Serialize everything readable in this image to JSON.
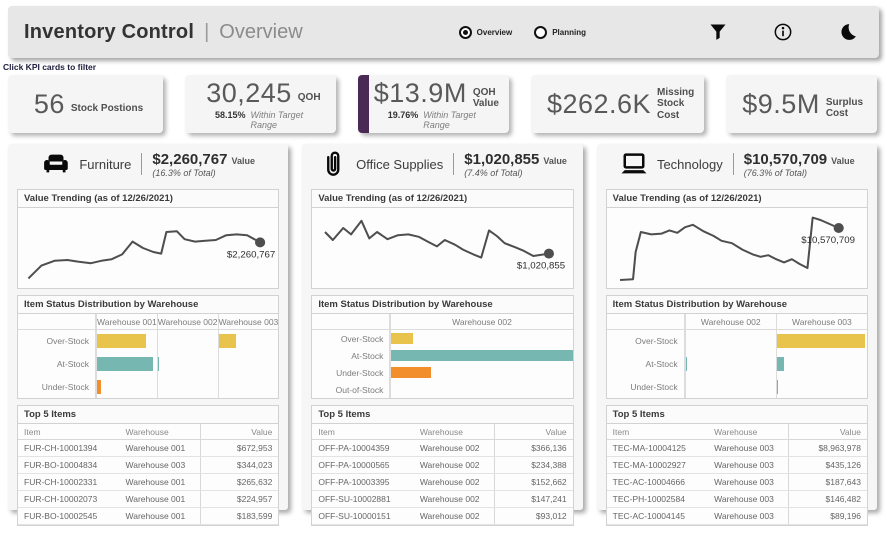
{
  "header": {
    "title": "Inventory Control",
    "separator": "|",
    "subtitle": "Overview",
    "views": [
      {
        "label": "Overview",
        "selected": true
      },
      {
        "label": "Planning",
        "selected": false
      }
    ],
    "icons": [
      "filter-icon",
      "info-icon",
      "dark-mode-icon"
    ]
  },
  "hint": "Click KPI cards to filter",
  "accent_color": "#4A2A55",
  "status_colors": {
    "Over-Stock": "#E8C44C",
    "At-Stock": "#76B7B2",
    "Under-Stock": "#F28E2B",
    "Out-of-Stock": "#F28E2B"
  },
  "trend_line_color": "#4e4e4e",
  "kpis": [
    {
      "value": "56",
      "label": "Stock Postions",
      "selected": false
    },
    {
      "value": "30,245",
      "label": "QOH",
      "sub_pct": "58.15%",
      "sub_text": "Within Target Range",
      "selected": false
    },
    {
      "value": "$13.9M",
      "label": "QOH Value",
      "sub_pct": "19.76%",
      "sub_text": "Within Target Range",
      "selected": true
    },
    {
      "value": "$262.6K",
      "label_lines": [
        "Missing",
        "Stock",
        "Cost"
      ],
      "selected": false
    },
    {
      "value": "$9.5M",
      "label": "Surplus Cost",
      "selected": false
    }
  ],
  "categories": [
    {
      "name": "Furniture",
      "icon": "couch-icon",
      "value": "$2,260,767",
      "value_suffix": "Value",
      "share": "(16.3% of Total)",
      "trend": {
        "title": "Value Trending (as of 12/26/2021)",
        "type": "line",
        "points": [
          [
            4,
            88
          ],
          [
            9,
            72
          ],
          [
            14,
            66
          ],
          [
            19,
            65
          ],
          [
            23,
            67
          ],
          [
            28,
            69
          ],
          [
            32,
            66
          ],
          [
            36,
            64
          ],
          [
            40,
            58
          ],
          [
            44,
            42
          ],
          [
            48,
            50
          ],
          [
            52,
            55
          ],
          [
            55,
            57
          ],
          [
            57,
            30
          ],
          [
            61,
            29
          ],
          [
            64,
            39
          ],
          [
            68,
            42
          ],
          [
            72,
            41
          ],
          [
            76,
            40
          ],
          [
            80,
            34
          ],
          [
            84,
            33
          ],
          [
            88,
            34
          ],
          [
            93,
            43
          ]
        ],
        "end_label": "$2,260,767"
      },
      "status": {
        "title": "Item Status Distribution by Warehouse",
        "columns": [
          "Warehouse 001",
          "Warehouse 002",
          "Warehouse 003"
        ],
        "rows": [
          {
            "label": "Over-Stock",
            "values": [
              0.82,
              0,
              0.3
            ]
          },
          {
            "label": "At-Stock",
            "values": [
              0.93,
              0.02,
              0
            ]
          },
          {
            "label": "Under-Stock",
            "values": [
              0.07,
              0,
              0
            ]
          }
        ]
      },
      "top5": {
        "title": "Top 5 Items",
        "headers": [
          "Item",
          "Warehouse",
          "Value"
        ],
        "rows": [
          [
            "FUR-CH-10001394",
            "Warehouse 001",
            "$672,953"
          ],
          [
            "FUR-BO-10004834",
            "Warehouse 003",
            "$344,023"
          ],
          [
            "FUR-CH-10002331",
            "Warehouse 001",
            "$265,632"
          ],
          [
            "FUR-CH-10002073",
            "Warehouse 001",
            "$224,957"
          ],
          [
            "FUR-BO-10002545",
            "Warehouse 001",
            "$183,599"
          ]
        ]
      }
    },
    {
      "name": "Office Supplies",
      "icon": "paperclip-icon",
      "value": "$1,020,855",
      "value_suffix": "Value",
      "share": "(7.4% of Total)",
      "trend": {
        "title": "Value Trending (as of 12/26/2021)",
        "type": "line",
        "points": [
          [
            5,
            30
          ],
          [
            8,
            40
          ],
          [
            12,
            25
          ],
          [
            15,
            33
          ],
          [
            19,
            16
          ],
          [
            22,
            38
          ],
          [
            25,
            30
          ],
          [
            29,
            39
          ],
          [
            33,
            34
          ],
          [
            37,
            33
          ],
          [
            41,
            36
          ],
          [
            45,
            43
          ],
          [
            48,
            48
          ],
          [
            51,
            40
          ],
          [
            55,
            46
          ],
          [
            58,
            52
          ],
          [
            62,
            58
          ],
          [
            65,
            62
          ],
          [
            68,
            28
          ],
          [
            71,
            35
          ],
          [
            74,
            44
          ],
          [
            78,
            49
          ],
          [
            81,
            53
          ],
          [
            85,
            60
          ],
          [
            91,
            57
          ]
        ],
        "end_label": "$1,020,855"
      },
      "status": {
        "title": "Item Status Distribution by Warehouse",
        "columns": [
          "Warehouse 002"
        ],
        "rows": [
          {
            "label": "Over-Stock",
            "values": [
              0.12
            ]
          },
          {
            "label": "At-Stock",
            "values": [
              1.0
            ]
          },
          {
            "label": "Under-Stock",
            "values": [
              0.22
            ]
          },
          {
            "label": "Out-of-Stock",
            "values": [
              0
            ]
          }
        ]
      },
      "top5": {
        "title": "Top 5 Items",
        "headers": [
          "Item",
          "Warehouse",
          "Value"
        ],
        "rows": [
          [
            "OFF-PA-10004359",
            "Warehouse 002",
            "$366,136"
          ],
          [
            "OFF-PA-10000565",
            "Warehouse 002",
            "$234,388"
          ],
          [
            "OFF-PA-10003395",
            "Warehouse 002",
            "$152,662"
          ],
          [
            "OFF-SU-10002881",
            "Warehouse 002",
            "$147,241"
          ],
          [
            "OFF-SU-10000151",
            "Warehouse 002",
            "$93,012"
          ]
        ]
      }
    },
    {
      "name": "Technology",
      "icon": "laptop-icon",
      "value": "$10,570,709",
      "value_suffix": "Value",
      "share": "(76.3% of Total)",
      "trend": {
        "title": "Value Trending (as of 12/26/2021)",
        "type": "line",
        "points": [
          [
            5,
            90
          ],
          [
            10,
            89
          ],
          [
            11,
            55
          ],
          [
            13,
            30
          ],
          [
            17,
            33
          ],
          [
            21,
            32
          ],
          [
            24,
            28
          ],
          [
            27,
            31
          ],
          [
            30,
            24
          ],
          [
            33,
            21
          ],
          [
            37,
            29
          ],
          [
            41,
            35
          ],
          [
            44,
            41
          ],
          [
            48,
            44
          ],
          [
            52,
            52
          ],
          [
            56,
            58
          ],
          [
            59,
            61
          ],
          [
            62,
            59
          ],
          [
            65,
            64
          ],
          [
            68,
            68
          ],
          [
            71,
            64
          ],
          [
            74,
            70
          ],
          [
            77,
            75
          ],
          [
            79,
            12
          ],
          [
            82,
            15
          ],
          [
            89,
            25
          ]
        ],
        "end_label": "$10,570,709"
      },
      "status": {
        "title": "Item Status Distribution by Warehouse",
        "columns": [
          "Warehouse 002",
          "Warehouse 003"
        ],
        "rows": [
          {
            "label": "Over-Stock",
            "values": [
              0,
              0.98
            ]
          },
          {
            "label": "At-Stock",
            "values": [
              0.015,
              0.08
            ]
          },
          {
            "label": "Under-Stock",
            "values": [
              0,
              0.005
            ]
          }
        ]
      },
      "top5": {
        "title": "Top 5 Items",
        "headers": [
          "Item",
          "Warehouse",
          "Value"
        ],
        "rows": [
          [
            "TEC-MA-10004125",
            "Warehouse 003",
            "$8,963,978"
          ],
          [
            "TEC-MA-10002927",
            "Warehouse 003",
            "$435,126"
          ],
          [
            "TEC-AC-10004666",
            "Warehouse 003",
            "$187,643"
          ],
          [
            "TEC-PH-10002584",
            "Warehouse 003",
            "$146,482"
          ],
          [
            "TEC-AC-10004145",
            "Warehouse 003",
            "$89,196"
          ]
        ]
      }
    }
  ]
}
